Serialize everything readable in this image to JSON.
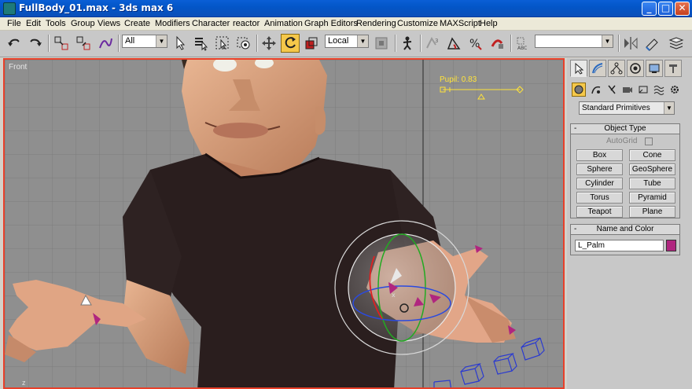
{
  "window": {
    "title": "FullBody_01.max - 3ds max 6",
    "minimize": "_",
    "maximize": "□",
    "close": "✕"
  },
  "menu": [
    "File",
    "Edit",
    "Tools",
    "Group",
    "Views",
    "Create",
    "Modifiers",
    "Character",
    "reactor",
    "Animation",
    "Graph Editors",
    "Rendering",
    "Customize",
    "MAXScript",
    "Help"
  ],
  "toolbar": {
    "selection_filter": "All",
    "coord_system": "Local",
    "named_selection": "",
    "icons": [
      "undo-icon",
      "redo-icon",
      "select-link-icon",
      "unlink-icon",
      "bind-spacewarp-icon",
      "select-object-icon",
      "select-by-name-icon",
      "region-select-icon",
      "window-crossing-icon",
      "move-icon",
      "rotate-icon",
      "scale-icon",
      "pivot-icon",
      "mirror-icon",
      "align-icon",
      "layers-icon"
    ]
  },
  "viewport": {
    "label": "Front",
    "manipulator_label": "Pupil: 0.83",
    "axis_label": "z"
  },
  "command_panel": {
    "tabs": [
      "create-tab",
      "modify-tab",
      "hierarchy-tab",
      "motion-tab",
      "display-tab",
      "utilities-tab"
    ],
    "category": "Standard Primitives",
    "object_type_title": "Object Type",
    "autogrid_label": "AutoGrid",
    "object_buttons": [
      "Box",
      "Cone",
      "Sphere",
      "GeoSphere",
      "Cylinder",
      "Tube",
      "Torus",
      "Pyramid",
      "Teapot",
      "Plane"
    ],
    "name_color_title": "Name and Color",
    "object_name": "L_Palm",
    "object_color": "#b0267f",
    "collapse_symbol": "-"
  },
  "colors": {
    "viewport_bg": "#8f8f8f",
    "active_border": "#e8402a",
    "shirt": "#2a1e1e",
    "skin": "#d9a07e",
    "manipulator": "#ffe33a",
    "titlebar": "#0a5fd6"
  }
}
